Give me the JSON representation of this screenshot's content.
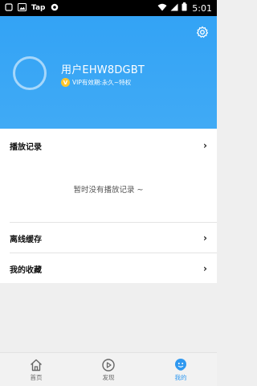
{
  "status_bar": {
    "app_label": "Tap",
    "time": "5:01"
  },
  "header": {
    "username": "用户EHW8DGBT",
    "vip_badge": "V",
    "vip_text": "VIP有效期:永久~特权"
  },
  "list": {
    "history_label": "播放记录",
    "empty_text": "暂时没有播放记录 ~",
    "offline_label": "离线缓存",
    "favorites_label": "我的收藏",
    "chevron": "›"
  },
  "bottom_nav": {
    "items": [
      {
        "label": "首页",
        "icon": "home-icon",
        "active": false
      },
      {
        "label": "发现",
        "icon": "play-circle-icon",
        "active": false
      },
      {
        "label": "我的",
        "icon": "profile-icon",
        "active": true
      }
    ]
  },
  "colors": {
    "accent": "#3aa5f4",
    "vip_gold": "#ffc62b",
    "active_nav": "#2f98f0"
  }
}
